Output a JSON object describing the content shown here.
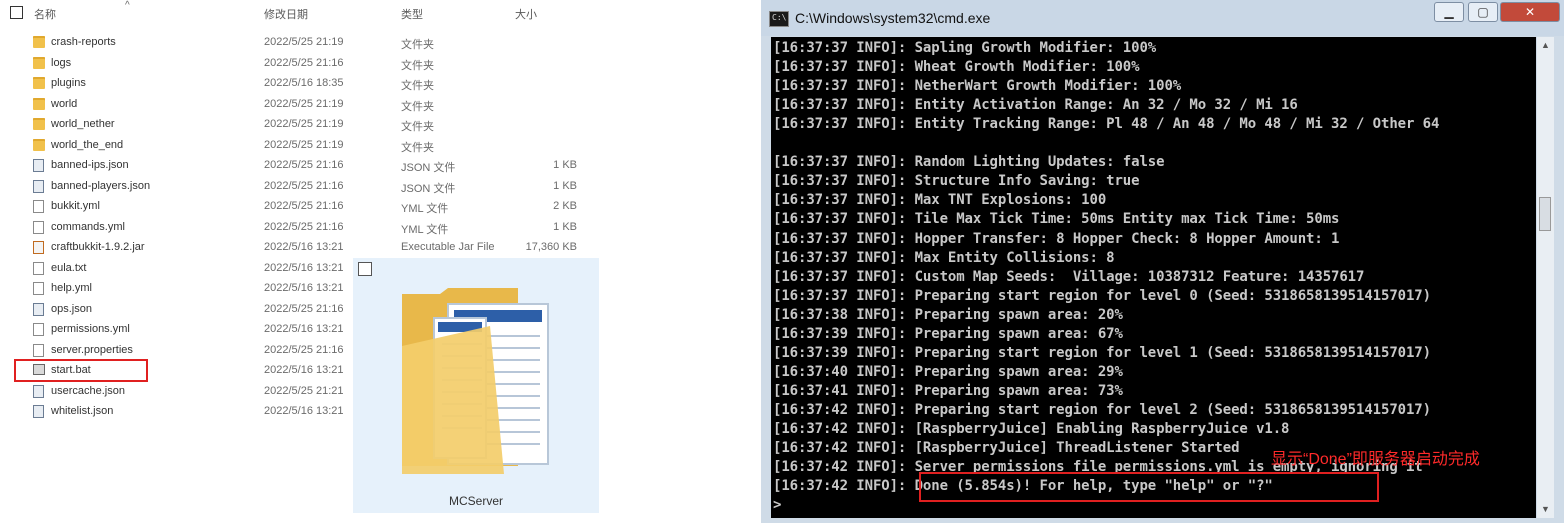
{
  "explorer": {
    "columns": {
      "name": "名称",
      "date": "修改日期",
      "type": "类型",
      "size": "大小"
    },
    "files": [
      {
        "name": "crash-reports",
        "date": "2022/5/25 21:19",
        "type": "文件夹",
        "size": "",
        "kind": "folder"
      },
      {
        "name": "logs",
        "date": "2022/5/25 21:16",
        "type": "文件夹",
        "size": "",
        "kind": "folder"
      },
      {
        "name": "plugins",
        "date": "2022/5/16 18:35",
        "type": "文件夹",
        "size": "",
        "kind": "folder"
      },
      {
        "name": "world",
        "date": "2022/5/25 21:19",
        "type": "文件夹",
        "size": "",
        "kind": "folder"
      },
      {
        "name": "world_nether",
        "date": "2022/5/25 21:19",
        "type": "文件夹",
        "size": "",
        "kind": "folder"
      },
      {
        "name": "world_the_end",
        "date": "2022/5/25 21:19",
        "type": "文件夹",
        "size": "",
        "kind": "folder"
      },
      {
        "name": "banned-ips.json",
        "date": "2022/5/25 21:16",
        "type": "JSON 文件",
        "size": "1 KB",
        "kind": "json"
      },
      {
        "name": "banned-players.json",
        "date": "2022/5/25 21:16",
        "type": "JSON 文件",
        "size": "1 KB",
        "kind": "json"
      },
      {
        "name": "bukkit.yml",
        "date": "2022/5/25 21:16",
        "type": "YML 文件",
        "size": "2 KB",
        "kind": "file"
      },
      {
        "name": "commands.yml",
        "date": "2022/5/25 21:16",
        "type": "YML 文件",
        "size": "1 KB",
        "kind": "file"
      },
      {
        "name": "craftbukkit-1.9.2.jar",
        "date": "2022/5/16 13:21",
        "type": "Executable Jar File",
        "size": "17,360 KB",
        "kind": "jar"
      },
      {
        "name": "eula.txt",
        "date": "2022/5/16 13:21",
        "type": "",
        "size": "",
        "kind": "file"
      },
      {
        "name": "help.yml",
        "date": "2022/5/16 13:21",
        "type": "",
        "size": "",
        "kind": "file"
      },
      {
        "name": "ops.json",
        "date": "2022/5/25 21:16",
        "type": "",
        "size": "",
        "kind": "json"
      },
      {
        "name": "permissions.yml",
        "date": "2022/5/16 13:21",
        "type": "",
        "size": "",
        "kind": "file"
      },
      {
        "name": "server.properties",
        "date": "2022/5/25 21:16",
        "type": "",
        "size": "",
        "kind": "file"
      },
      {
        "name": "start.bat",
        "date": "2022/5/16 13:21",
        "type": "",
        "size": "",
        "kind": "bat"
      },
      {
        "name": "usercache.json",
        "date": "2022/5/25 21:21",
        "type": "",
        "size": "",
        "kind": "json"
      },
      {
        "name": "whitelist.json",
        "date": "2022/5/16 13:21",
        "type": "",
        "size": "",
        "kind": "json"
      }
    ],
    "preview_label": "MCServer"
  },
  "cmd": {
    "title": "C:\\Windows\\system32\\cmd.exe",
    "icon_text": "C:\\",
    "lines": [
      "[16:37:37 INFO]: Sapling Growth Modifier: 100%",
      "[16:37:37 INFO]: Wheat Growth Modifier: 100%",
      "[16:37:37 INFO]: NetherWart Growth Modifier: 100%",
      "[16:37:37 INFO]: Entity Activation Range: An 32 / Mo 32 / Mi 16",
      "[16:37:37 INFO]: Entity Tracking Range: Pl 48 / An 48 / Mo 48 / Mi 32 / Other 64",
      "",
      "[16:37:37 INFO]: Random Lighting Updates: false",
      "[16:37:37 INFO]: Structure Info Saving: true",
      "[16:37:37 INFO]: Max TNT Explosions: 100",
      "[16:37:37 INFO]: Tile Max Tick Time: 50ms Entity max Tick Time: 50ms",
      "[16:37:37 INFO]: Hopper Transfer: 8 Hopper Check: 8 Hopper Amount: 1",
      "[16:37:37 INFO]: Max Entity Collisions: 8",
      "[16:37:37 INFO]: Custom Map Seeds:  Village: 10387312 Feature: 14357617",
      "[16:37:37 INFO]: Preparing start region for level 0 (Seed: 5318658139514157017)",
      "[16:37:38 INFO]: Preparing spawn area: 20%",
      "[16:37:39 INFO]: Preparing spawn area: 67%",
      "[16:37:39 INFO]: Preparing start region for level 1 (Seed: 5318658139514157017)",
      "[16:37:40 INFO]: Preparing spawn area: 29%",
      "[16:37:41 INFO]: Preparing spawn area: 73%",
      "[16:37:42 INFO]: Preparing start region for level 2 (Seed: 5318658139514157017)",
      "[16:37:42 INFO]: [RaspberryJuice] Enabling RaspberryJuice v1.8",
      "[16:37:42 INFO]: [RaspberryJuice] ThreadListener Started",
      "[16:37:42 INFO]: Server permissions file permissions.yml is empty, ignoring it",
      "[16:37:42 INFO]: Done (5.854s)! For help, type \"help\" or \"?\"",
      ">"
    ],
    "annotation": "显示“Done”即服务器启动完成",
    "buttons": {
      "minimize": "▁",
      "maximize": "▢",
      "close": "✕"
    }
  },
  "colors": {
    "highlight": "#e02020",
    "annotation": "#ff2a2a",
    "console_bg": "#000000",
    "console_fg": "#c8c8c8"
  }
}
